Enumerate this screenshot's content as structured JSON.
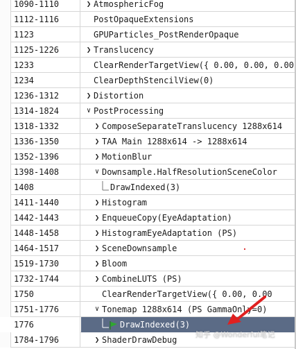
{
  "rows": [
    {
      "eid": "1090-1110",
      "name": "AtmosphericFog",
      "depth": 0,
      "toggle": "collapsed"
    },
    {
      "eid": "1112-1116",
      "name": "PostOpaqueExtensions",
      "depth": 0,
      "toggle": "none"
    },
    {
      "eid": "1123",
      "name": "GPUParticles_PostRenderOpaque",
      "depth": 0,
      "toggle": "none"
    },
    {
      "eid": "1125-1226",
      "name": "Translucency",
      "depth": 0,
      "toggle": "collapsed"
    },
    {
      "eid": "1233",
      "name": "ClearRenderTargetView({ 0.00, 0.00, 0.00",
      "depth": 0,
      "toggle": "none"
    },
    {
      "eid": "1234",
      "name": "ClearDepthStencilView(0)",
      "depth": 0,
      "toggle": "none"
    },
    {
      "eid": "1236-1312",
      "name": "Distortion",
      "depth": 0,
      "toggle": "collapsed"
    },
    {
      "eid": "1314-1824",
      "name": "PostProcessing",
      "depth": 0,
      "toggle": "expanded"
    },
    {
      "eid": "1318-1332",
      "name": "ComposeSeparateTranslucency 1288x614",
      "depth": 1,
      "toggle": "collapsed"
    },
    {
      "eid": "1336-1350",
      "name": "TAA Main 1288x614 -> 1288x614",
      "depth": 1,
      "toggle": "collapsed"
    },
    {
      "eid": "1352-1396",
      "name": "MotionBlur",
      "depth": 1,
      "toggle": "collapsed"
    },
    {
      "eid": "1398-1408",
      "name": "Downsample.HalfResolutionSceneColor",
      "depth": 1,
      "toggle": "expanded"
    },
    {
      "eid": "1408",
      "name": "DrawIndexed(3)",
      "depth": 2,
      "toggle": "none"
    },
    {
      "eid": "1411-1440",
      "name": "Histogram",
      "depth": 1,
      "toggle": "collapsed"
    },
    {
      "eid": "1442-1443",
      "name": "EnqueueCopy(EyeAdaptation)",
      "depth": 1,
      "toggle": "collapsed"
    },
    {
      "eid": "1448-1458",
      "name": "HistogramEyeAdaptation (PS)",
      "depth": 1,
      "toggle": "collapsed"
    },
    {
      "eid": "1464-1517",
      "name": "SceneDownsample",
      "depth": 1,
      "toggle": "collapsed"
    },
    {
      "eid": "1519-1730",
      "name": "Bloom",
      "depth": 1,
      "toggle": "collapsed"
    },
    {
      "eid": "1732-1744",
      "name": "CombineLUTS (PS)",
      "depth": 1,
      "toggle": "collapsed"
    },
    {
      "eid": "1750",
      "name": "ClearRenderTargetView({ 0.00, 0.00",
      "depth": 1,
      "toggle": "none"
    },
    {
      "eid": "1751-1776",
      "name": "Tonemap 1288x614 (PS GammaOnly=0)",
      "depth": 1,
      "toggle": "expanded"
    },
    {
      "eid": "1776",
      "name": "DrawIndexed(3)",
      "depth": 2,
      "toggle": "none",
      "selected": true,
      "icon": "flag-icon"
    },
    {
      "eid": "1784-1796",
      "name": "ShaderDrawDebug",
      "depth": 1,
      "toggle": "collapsed"
    }
  ],
  "watermark": "知乎 @Wonderful笔记",
  "colors": {
    "selection": "#5b6b86",
    "flag": "#2fa82f",
    "annotation_arrow": "#e02020",
    "grid_line": "#d6d6d6"
  }
}
